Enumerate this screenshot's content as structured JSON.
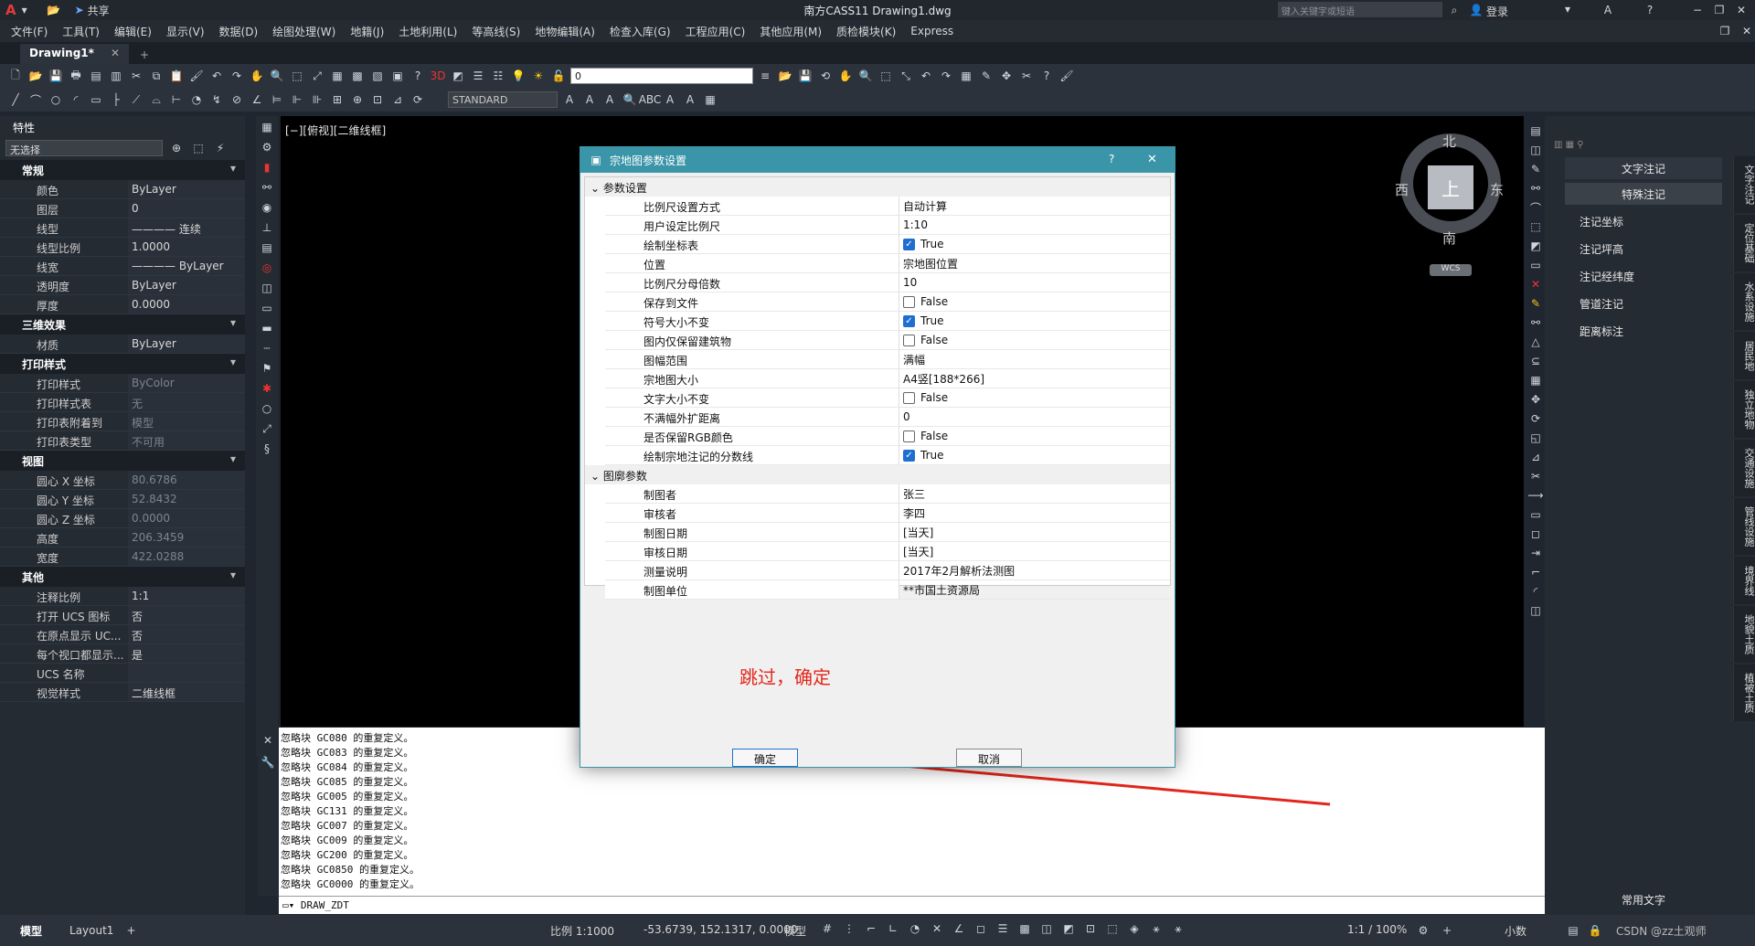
{
  "title": {
    "logo": "A",
    "share": "共享",
    "caption": "南方CASS11    Drawing1.dwg",
    "search_placeholder": "键入关键字或短语",
    "login": "登录"
  },
  "menu": [
    "文件(F)",
    "工具(T)",
    "编辑(E)",
    "显示(V)",
    "数据(D)",
    "绘图处理(W)",
    "地籍(J)",
    "土地利用(L)",
    "等高线(S)",
    "地物编辑(A)",
    "检查入库(G)",
    "工程应用(C)",
    "其他应用(M)",
    "质检模块(K)",
    "Express"
  ],
  "file_tab": {
    "label": "Drawing1*",
    "close": "✕",
    "add": "+"
  },
  "toolbar": {
    "layer_value": "0",
    "text_style": "STANDARD"
  },
  "properties": {
    "title": "特性",
    "selection": "无选择",
    "sections": [
      {
        "name": "常规",
        "rows": [
          [
            "颜色",
            "ByLayer"
          ],
          [
            "图层",
            "0"
          ],
          [
            "线型",
            "———— 连续"
          ],
          [
            "线型比例",
            "1.0000"
          ],
          [
            "线宽",
            "———— ByLayer"
          ],
          [
            "透明度",
            "ByLayer"
          ],
          [
            "厚度",
            "0.0000"
          ]
        ]
      },
      {
        "name": "三维效果",
        "rows": [
          [
            "材质",
            "ByLayer"
          ]
        ]
      },
      {
        "name": "打印样式",
        "rows": [
          [
            "打印样式",
            "ByColor"
          ],
          [
            "打印样式表",
            "无"
          ],
          [
            "打印表附着到",
            "模型"
          ],
          [
            "打印表类型",
            "不可用"
          ]
        ]
      },
      {
        "name": "视图",
        "rows": [
          [
            "圆心 X 坐标",
            "80.6786"
          ],
          [
            "圆心 Y 坐标",
            "52.8432"
          ],
          [
            "圆心 Z 坐标",
            "0.0000"
          ],
          [
            "高度",
            "206.3459"
          ],
          [
            "宽度",
            "422.0288"
          ]
        ]
      },
      {
        "name": "其他",
        "rows": [
          [
            "注释比例",
            "1:1"
          ],
          [
            "打开 UCS 图标",
            "否"
          ],
          [
            "在原点显示 UC...",
            "否"
          ],
          [
            "每个视口都显示...",
            "是"
          ],
          [
            "UCS 名称",
            ""
          ],
          [
            "视觉样式",
            "二维线框"
          ]
        ]
      }
    ]
  },
  "viewport": {
    "label": "[−][俯视][二维线框]",
    "compass": {
      "n": "北",
      "s": "南",
      "e": "东",
      "w": "西",
      "top": "上",
      "wcs": "WCS"
    }
  },
  "dialog": {
    "title": "宗地图参数设置",
    "help": "?",
    "close": "✕",
    "cat1": "参数设置",
    "params": [
      {
        "k": "比例尺设置方式",
        "v": "自动计算"
      },
      {
        "k": "用户设定比例尺",
        "v": "1:10"
      },
      {
        "k": "绘制坐标表",
        "v": "True",
        "cb": true
      },
      {
        "k": "位置",
        "v": "宗地图位置"
      },
      {
        "k": "比例尺分母倍数",
        "v": "10"
      },
      {
        "k": "保存到文件",
        "v": "False",
        "cb": false
      },
      {
        "k": "符号大小不变",
        "v": "True",
        "cb": true
      },
      {
        "k": "图内仅保留建筑物",
        "v": "False",
        "cb": false
      },
      {
        "k": "图幅范围",
        "v": "满幅"
      },
      {
        "k": "宗地图大小",
        "v": "A4竖[188*266]"
      },
      {
        "k": "文字大小不变",
        "v": "False",
        "cb": false
      },
      {
        "k": "不满幅外扩距离",
        "v": "0"
      },
      {
        "k": "是否保留RGB颜色",
        "v": "False",
        "cb": false
      },
      {
        "k": "绘制宗地注记的分数线",
        "v": "True",
        "cb": true
      }
    ],
    "cat2": "图廓参数",
    "frame": [
      {
        "k": "制图者",
        "v": "张三"
      },
      {
        "k": "审核者",
        "v": "李四"
      },
      {
        "k": "制图日期",
        "v": "[当天]"
      },
      {
        "k": "审核日期",
        "v": "[当天]"
      },
      {
        "k": "测量说明",
        "v": "2017年2月解析法测图"
      },
      {
        "k": "制图单位",
        "v": "**市国土资源局"
      }
    ],
    "annotation": "跳过，确定",
    "ok": "确定",
    "cancel": "取消"
  },
  "command_history": [
    "忽略块 GC080 的重复定义。",
    "忽略块 GC083 的重复定义。",
    "忽略块 GC084 的重复定义。",
    "忽略块 GC085 的重复定义。",
    "忽略块 GC005 的重复定义。",
    "忽略块 GC131 的重复定义。",
    "忽略块 GC007 的重复定义。",
    "忽略块 GC009 的重复定义。",
    "忽略块 GC200 的重复定义。",
    "忽略块 GC0850 的重复定义。",
    "忽略块 GC0000 的重复定义。"
  ],
  "command_input": "DRAW_ZDT",
  "right_panel": {
    "tabs": [
      "文字注记",
      "特殊注记"
    ],
    "items": [
      "注记坐标",
      "注记坪高",
      "注记经纬度",
      "管道注记",
      "距离标注"
    ],
    "footer": "常用文字",
    "vertical": [
      "文字注记",
      "定位基础",
      "水系设施",
      "居民地",
      "独立地物",
      "交通设施",
      "管线设施",
      "境界线",
      "地貌土质",
      "植被土质"
    ]
  },
  "status": {
    "model_tab": "模型",
    "layout_tab": "Layout1",
    "add": "+",
    "scale": "比例 1:1000",
    "coords": "-53.6739, 152.1317, 0.0000",
    "space": "模型",
    "anno": "1:1 / 100%",
    "units": "小数",
    "watermark": "CSDN @zz土观师"
  }
}
